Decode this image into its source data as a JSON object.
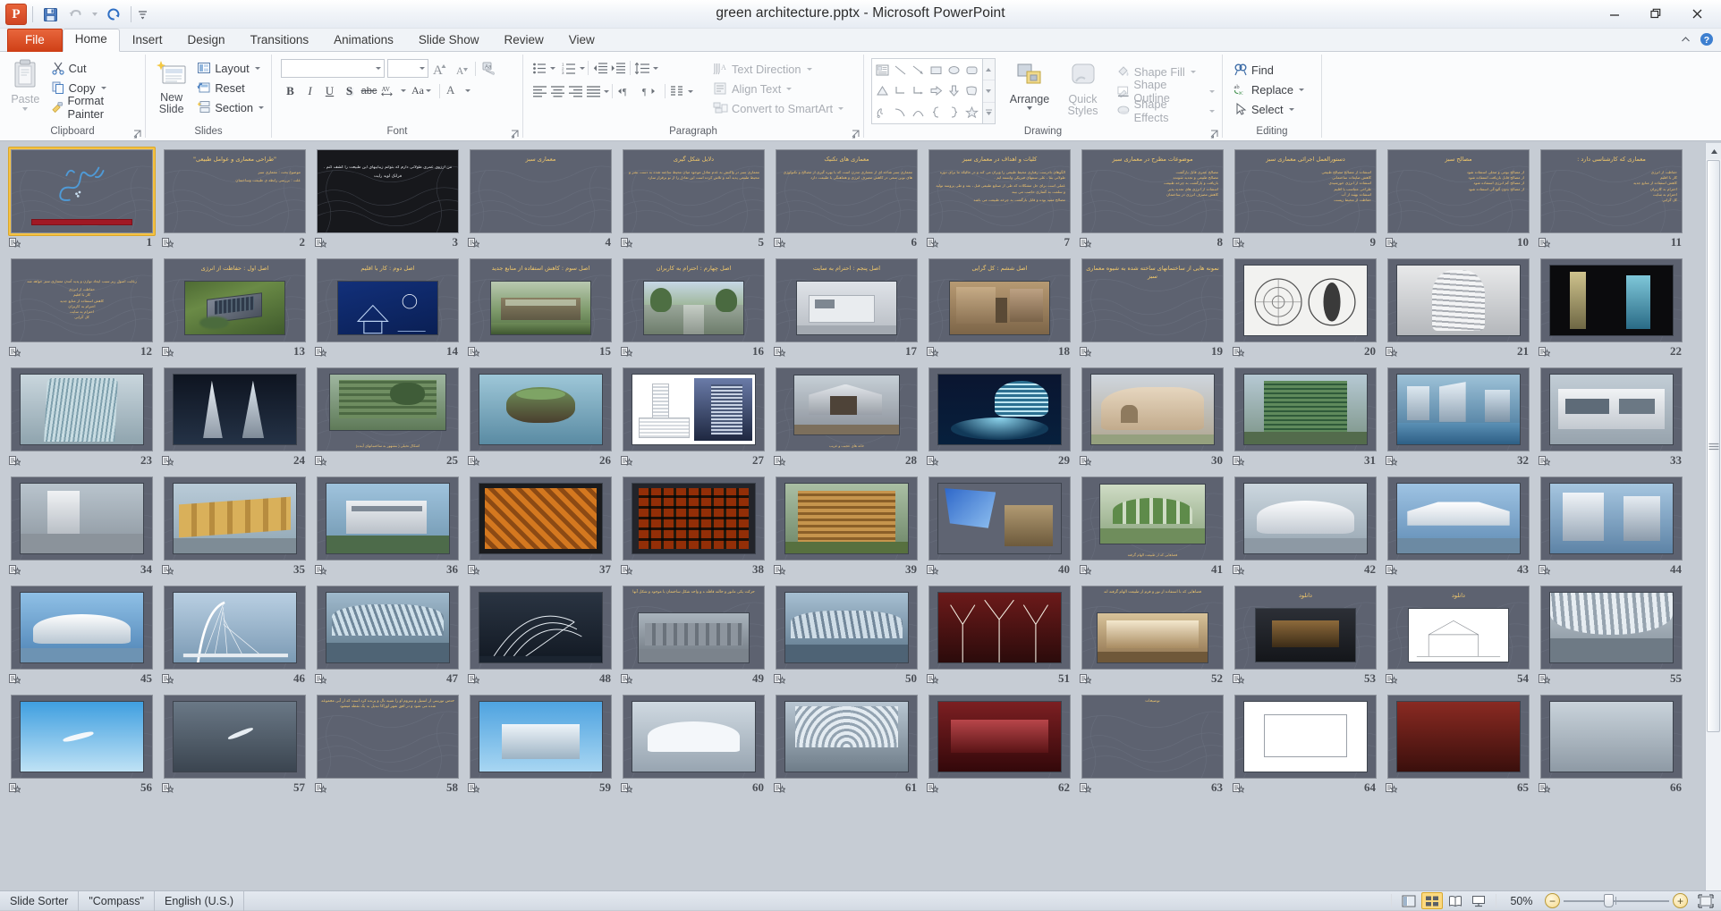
{
  "window": {
    "title": "green architecture.pptx  -  Microsoft PowerPoint",
    "minimize_label": "Minimize",
    "restore_label": "Restore",
    "close_label": "Close"
  },
  "quick_access": {
    "app_letter": "P",
    "items": [
      "save-icon",
      "undo-icon",
      "redo-icon",
      "customize-icon"
    ]
  },
  "tabs": [
    {
      "label": "File",
      "kind": "file"
    },
    {
      "label": "Home",
      "kind": "active"
    },
    {
      "label": "Insert",
      "kind": "normal"
    },
    {
      "label": "Design",
      "kind": "normal"
    },
    {
      "label": "Transitions",
      "kind": "normal"
    },
    {
      "label": "Animations",
      "kind": "normal"
    },
    {
      "label": "Slide Show",
      "kind": "normal"
    },
    {
      "label": "Review",
      "kind": "normal"
    },
    {
      "label": "View",
      "kind": "normal"
    }
  ],
  "ribbon": {
    "groups": [
      {
        "name": "Clipboard",
        "label": "Clipboard"
      },
      {
        "name": "Slides",
        "label": "Slides"
      },
      {
        "name": "Font",
        "label": "Font"
      },
      {
        "name": "Paragraph",
        "label": "Paragraph"
      },
      {
        "name": "Drawing",
        "label": "Drawing"
      },
      {
        "name": "Editing",
        "label": "Editing"
      }
    ],
    "clipboard": {
      "paste": "Paste",
      "cut": "Cut",
      "copy": "Copy",
      "format_painter": "Format Painter"
    },
    "slides": {
      "new_slide_l1": "New",
      "new_slide_l2": "Slide",
      "layout": "Layout",
      "reset": "Reset",
      "section": "Section"
    },
    "font": {
      "font_name_value": "",
      "font_name_placeholder": "",
      "font_size_value": "",
      "bold": "B",
      "italic": "I",
      "underline": "U",
      "shadow": "S",
      "strikethrough": "abc",
      "spacing": "AV",
      "change_case": "Aa",
      "font_color": "A",
      "grow_font": "A",
      "shrink_font": "A",
      "clear_formatting": "clear-formatting"
    },
    "paragraph": {
      "text_direction": "Text Direction",
      "align_text": "Align Text",
      "convert_smartart": "Convert to SmartArt"
    },
    "drawing": {
      "arrange_label": "Arrange",
      "quick_styles_l1": "Quick",
      "quick_styles_l2": "Styles",
      "shape_fill": "Shape Fill",
      "shape_outline": "Shape Outline",
      "shape_effects": "Shape Effects"
    },
    "editing": {
      "find": "Find",
      "replace": "Replace",
      "select": "Select"
    }
  },
  "status_bar": {
    "view_name": "Slide Sorter",
    "theme_name": "\"Compass\"",
    "language": "English (U.S.)",
    "zoom_percent": "50%",
    "views": [
      {
        "name": "normal-view",
        "label": "Normal",
        "active": false
      },
      {
        "name": "slide-sorter-view",
        "label": "Slide Sorter",
        "active": true
      },
      {
        "name": "reading-view",
        "label": "Reading View",
        "active": false
      },
      {
        "name": "slide-show-view",
        "label": "Slide Show",
        "active": false
      }
    ],
    "zoom_out": "−",
    "zoom_in": "+",
    "fit_window": "Fit slide to current window"
  },
  "slides": [
    {
      "n": "1",
      "kind": "cover",
      "selected": true,
      "title": "",
      "body": ""
    },
    {
      "n": "2",
      "kind": "text",
      "title": "\"طراحی معماری و عوامل طبیعی\"",
      "body": "موضوع بحث : معماری سبز\n\nعلت : بررسی رابطه ی طبیعت وساختمان"
    },
    {
      "n": "3",
      "kind": "dark-text",
      "title": "",
      "body": "من آرزوی عمری طولانی دارم که بتوانم زیباییهای این طبیعت را کشف کنم .\n\nفرانک لوید رایت"
    },
    {
      "n": "4",
      "kind": "text",
      "title": "معماری سبز",
      "body": ""
    },
    {
      "n": "5",
      "kind": "text",
      "title": "دلایل شکل گیری",
      "body": "معماری سبز در واکنش به عدم تعادل موجود میان محیط ساخته شده به دست بشر و محیط طبیعی پدید آمد و تلاش کرده است این تعادل را از نو برقرار سازد"
    },
    {
      "n": "6",
      "kind": "text",
      "title": "معماری های تکنیک",
      "body": "معماری سبز شاخه ای از معماری مدرن است که با بهره گیری از مصالح و تکنولوژی های نوین سعی در کاهش مصرف انرژی و هماهنگی با طبیعت دارد"
    },
    {
      "n": "7",
      "kind": "text",
      "title": "کلیات و اهداف در معماری سبز",
      "body": "الگوهای نادرست رفتاری محیط طبیعی را ویران می کند و در حالیکه ما برای دوره طولانی بقا ، علی سنتهای فیزیکی وابسته ایم .\n\nعملی است برای حل مشکلات که طی از صنایع طبیعی قبل ، بعد و طی پروسه تولید و سلمت به گفتاری حاصب می بیند\n\nمصالح مفید بوده و قابل بازگشت به چرخه طبیعت می باشد"
    },
    {
      "n": "8",
      "kind": "text",
      "title": "موضوعات مطرح در معماری سبز",
      "body": "مصالح عمری قابل بازگشت\nمصالح طبیعی و تجدید شونده\nبازیافت و بازگشت به چرخه طبیعت\nاستفاده از انرژی های تجدید پذیر\nکاهش مصرف انرژی در ساختمان"
    },
    {
      "n": "9",
      "kind": "text",
      "title": "دستورالعمل اجرائی معماری سبز",
      "body": "استفاده از مصالح مصالح طبیعی\nکاهش ضایعات ساختمانی\nاستفاده از انرژی خورشیدی\nطراحی متناسب با اقلیم\nاستفاده بهینه از آب\nحفاظت از محیط زیست"
    },
    {
      "n": "10",
      "kind": "text",
      "title": "مصالح سبز",
      "body": "از مصالح بومی و محلی استفاده شود\nاز مصالح قابل بازیافت استفاده شود\nاز مصالح کم انرژی استفاده شود\nاز مصالح بدون آلودگی استفاده شود"
    },
    {
      "n": "11",
      "kind": "text",
      "title": "معماری که کارشناسی دارد :",
      "body": "حفاظت از انرژی\nکار با اقلیم\nکاهش استفاده از منابع جدید\nاحترام به کاربران\nاحترام به سایت\nکل گرایی"
    },
    {
      "n": "12",
      "kind": "text",
      "title": "",
      "body": "رعایت اصول زیر سبب ایجاد توازن و پدید آمدن معماری سبز خواهد شد\n\nحفاظت از انرژی\nکار با اقلیم\nکاهش استفاده از منابع جدید\nاحترام به کاربران\nاحترام به سایت\nکل گرایی"
    },
    {
      "n": "13",
      "kind": "titled-photo",
      "title": "اصل اول : حفاظت از انرژی",
      "photo": "aerial-house-solar"
    },
    {
      "n": "14",
      "kind": "titled-photo",
      "title": "اصل دوم : کار با اقلیم",
      "photo": "blue-diagram"
    },
    {
      "n": "15",
      "kind": "titled-photo",
      "title": "اصل سوم : کاهش استفاده از منابع جدید",
      "photo": "green-building"
    },
    {
      "n": "16",
      "kind": "titled-photo",
      "title": "اصل چهارم : احترام به کاربران",
      "photo": "walkway-trees"
    },
    {
      "n": "17",
      "kind": "titled-photo",
      "title": "اصل پنجم : احترام به سایت",
      "photo": "white-house-sketch"
    },
    {
      "n": "18",
      "kind": "titled-photo",
      "title": "اصل ششم : کل گرایی",
      "photo": "stone-courtyard"
    },
    {
      "n": "19",
      "kind": "text",
      "title": "نمونه هایی از ساختمانهای ساخته شده به شیوه معماری سبز",
      "body": ""
    },
    {
      "n": "20",
      "kind": "photo",
      "photo": "two-circular-diagrams"
    },
    {
      "n": "21",
      "kind": "photo",
      "photo": "spiral-tower"
    },
    {
      "n": "22",
      "kind": "photo",
      "photo": "two-towers-black"
    },
    {
      "n": "23",
      "kind": "photo",
      "photo": "glass-twist-tower"
    },
    {
      "n": "24",
      "kind": "photo",
      "photo": "twin-sail-towers"
    },
    {
      "n": "25",
      "kind": "titled-photo-bottom",
      "title": "اشکال تخیلی ( مشهور به ساختمانهای آینده)",
      "photo": "green-facade"
    },
    {
      "n": "26",
      "kind": "photo",
      "photo": "floating-island"
    },
    {
      "n": "27",
      "kind": "photo",
      "photo": "tower-elevation"
    },
    {
      "n": "28",
      "kind": "photo-cap",
      "photo": "treehouse",
      "caption": "خانه های عجیب و غریب"
    },
    {
      "n": "29",
      "kind": "photo",
      "photo": "city-hall-london"
    },
    {
      "n": "30",
      "kind": "photo",
      "photo": "curvy-adobe-house"
    },
    {
      "n": "31",
      "kind": "photo",
      "photo": "green-glass-tower"
    },
    {
      "n": "32",
      "kind": "photo",
      "photo": "waterfront-towers"
    },
    {
      "n": "33",
      "kind": "photo",
      "photo": "white-modern-house"
    },
    {
      "n": "34",
      "kind": "photo",
      "photo": "monolith-plaza"
    },
    {
      "n": "35",
      "kind": "photo",
      "photo": "cube-houses"
    },
    {
      "n": "36",
      "kind": "photo",
      "photo": "hillside-villa"
    },
    {
      "n": "37",
      "kind": "photo",
      "photo": "orange-facade-pattern"
    },
    {
      "n": "38",
      "kind": "photo",
      "photo": "colored-window-grid"
    },
    {
      "n": "39",
      "kind": "photo",
      "photo": "wooden-louvre-building"
    },
    {
      "n": "40",
      "kind": "photo",
      "photo": "blue-art-and-tower"
    },
    {
      "n": "41",
      "kind": "photo-cap",
      "photo": "green-arches",
      "caption": "فضاهایی که از طبیعت الهام گرفته"
    },
    {
      "n": "42",
      "kind": "photo",
      "photo": "white-shell-pavilion"
    },
    {
      "n": "43",
      "kind": "photo",
      "photo": "milwaukee-museum"
    },
    {
      "n": "44",
      "kind": "photo",
      "photo": "calatrava-skyline"
    },
    {
      "n": "45",
      "kind": "photo",
      "photo": "valencia-opera"
    },
    {
      "n": "46",
      "kind": "photo",
      "photo": "harp-bridge"
    },
    {
      "n": "47",
      "kind": "photo",
      "photo": "glass-roof-structure"
    },
    {
      "n": "48",
      "kind": "photo",
      "photo": "wire-sculpture-building"
    },
    {
      "n": "49",
      "kind": "text-photo",
      "title": "حرکت یکی مانور و حالته قافله ه و واحد شکل ساختمان با موجود و شکل آنها",
      "photo": "industrial-yard"
    },
    {
      "n": "50",
      "kind": "photo",
      "photo": "airport-terminal"
    },
    {
      "n": "51",
      "kind": "photo",
      "photo": "red-tree-columns"
    },
    {
      "n": "52",
      "kind": "text-photo",
      "title": "فضاهایی که با استفاده از نور و فرم از طبیعت الهام گرفته اند",
      "photo": "atrium-interior"
    },
    {
      "n": "53",
      "kind": "titled-photo",
      "title": "دانلود",
      "photo": "auditorium-dark"
    },
    {
      "n": "54",
      "kind": "titled-photo",
      "title": "دانلود",
      "photo": "sketch-white"
    },
    {
      "n": "55",
      "kind": "photo",
      "photo": "curved-ceiling-hall"
    },
    {
      "n": "56",
      "kind": "photo-partial",
      "photo": "sky-plane"
    },
    {
      "n": "57",
      "kind": "photo-partial",
      "photo": "cloud-plane"
    },
    {
      "n": "58",
      "kind": "text-partial",
      "title": "حدس توربینی از استیل و نیتروم او را شبیه بال و پرنده کرد است که از آبی مجموعه شده می شود و در افق شهر اوزاکا تبدیل به یک نقطه میشود"
    },
    {
      "n": "59",
      "kind": "photo-partial",
      "photo": "blue-sky-building"
    },
    {
      "n": "60",
      "kind": "photo-partial",
      "photo": "white-pavilion"
    },
    {
      "n": "61",
      "kind": "photo-partial",
      "photo": "dome-interior"
    },
    {
      "n": "62",
      "kind": "photo-partial",
      "photo": "red-hall"
    },
    {
      "n": "63",
      "kind": "text-partial",
      "title": "توضیحات"
    },
    {
      "n": "64",
      "kind": "photo-partial",
      "photo": "white-frame"
    },
    {
      "n": "65",
      "kind": "photo-partial",
      "photo": "red-interior"
    },
    {
      "n": "66",
      "kind": "photo-partial",
      "photo": "last-slide"
    }
  ]
}
